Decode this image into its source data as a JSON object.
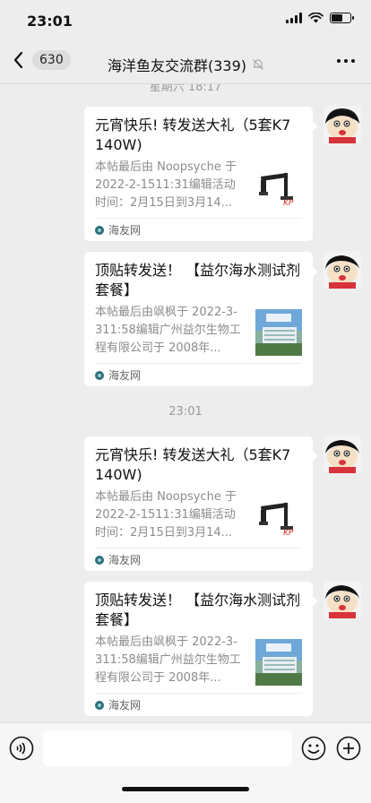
{
  "status_bar": {
    "time": "23:01"
  },
  "nav": {
    "unread_count": "630",
    "title": "海洋鱼友交流群(339)"
  },
  "chat": {
    "timestamps": [
      "星期六 18:17",
      "23:01"
    ],
    "messages": [
      {
        "title": "元宵快乐! 转发送大礼（5套K7  140W)",
        "desc": "本帖最后由 Noopsyche 于 2022-2-1511:31编辑活动时间：2月15日到3月14...",
        "source": "海友网",
        "thumb": "lamp"
      },
      {
        "title": "顶贴转发送！ 【益尔海水测试剂套餐】",
        "desc": "本帖最后由飒枫于 2022-3-311:58编辑广州益尔生物工程有限公司于 2008年...",
        "source": "海友网",
        "thumb": "building"
      },
      {
        "title": "元宵快乐! 转发送大礼（5套K7  140W)",
        "desc": "本帖最后由 Noopsyche 于 2022-2-1511:31编辑活动时间：2月15日到3月14...",
        "source": "海友网",
        "thumb": "lamp"
      },
      {
        "title": "顶贴转发送！ 【益尔海水测试剂套餐】",
        "desc": "本帖最后由飒枫于 2022-3-311:58编辑广州益尔生物工程有限公司于 2008年...",
        "source": "海友网",
        "thumb": "building"
      }
    ]
  },
  "input": {
    "placeholder": ""
  },
  "colors": {
    "background": "#ededed",
    "card": "#ffffff",
    "secondary_text": "#8c8c8c"
  }
}
